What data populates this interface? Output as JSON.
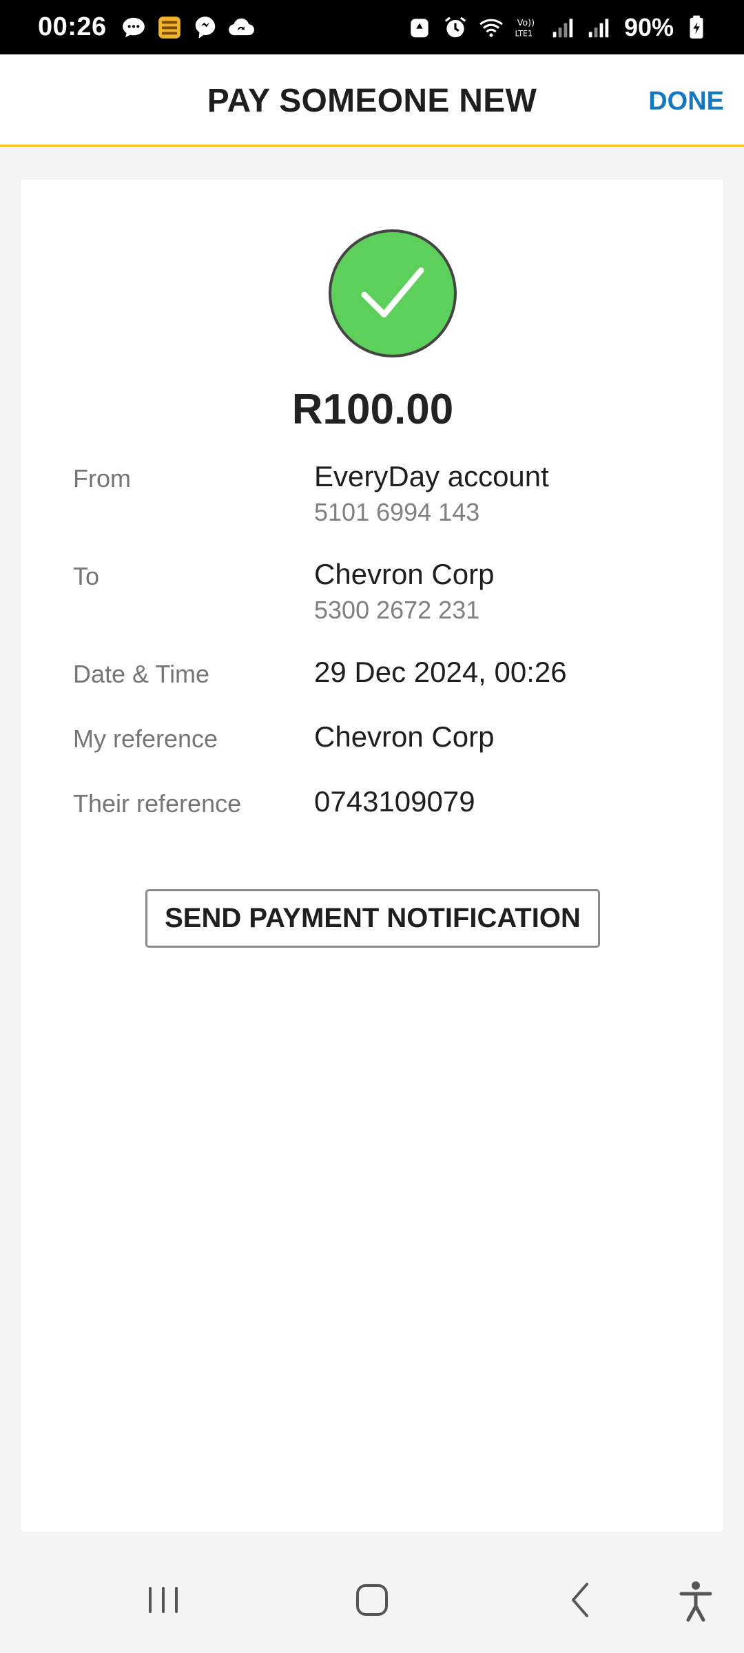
{
  "status_bar": {
    "time": "00:26",
    "battery": "90%",
    "left_icons": [
      "chat-bubble-icon",
      "stack-app-icon",
      "messenger-icon",
      "cloud-sync-icon"
    ],
    "right_icons": [
      "recycle-icon",
      "alarm-icon",
      "wifi-icon",
      "volte-icon",
      "signal-icon",
      "signal-icon",
      "battery-icon"
    ]
  },
  "header": {
    "title": "PAY SOMEONE NEW",
    "done_label": "DONE"
  },
  "colors": {
    "accent_yellow": "#f3c316",
    "link_blue": "#1577bd",
    "success_green": "#5dcf5b"
  },
  "confirmation": {
    "amount": "R100.00",
    "details": {
      "from": {
        "label": "From",
        "value": "EveryDay account",
        "sub": "5101 6994 143"
      },
      "to": {
        "label": "To",
        "value": "Chevron Corp",
        "sub": "5300 2672 231"
      },
      "datetime": {
        "label": "Date & Time",
        "value": "29 Dec 2024, 00:26"
      },
      "my_reference": {
        "label": "My reference",
        "value": "Chevron Corp"
      },
      "their_reference": {
        "label": "Their reference",
        "value": "0743109079"
      }
    },
    "notify_button_label": "SEND PAYMENT NOTIFICATION"
  },
  "nav": {
    "buttons": [
      "recents-icon",
      "home-icon",
      "back-icon",
      "accessibility-icon"
    ]
  }
}
